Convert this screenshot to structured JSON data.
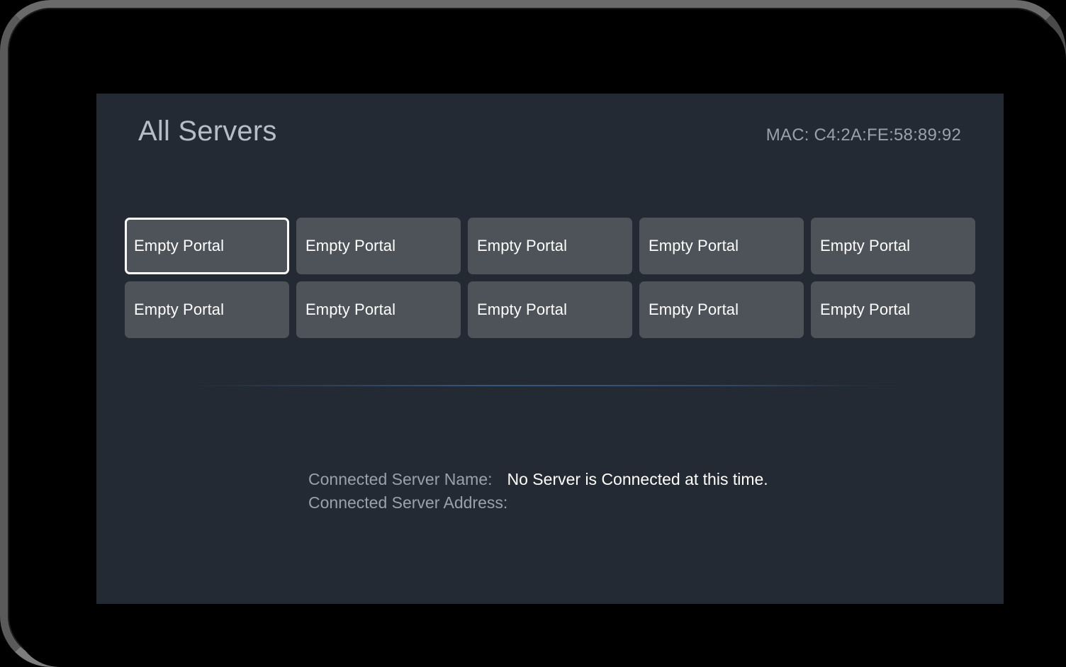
{
  "device": {
    "bezel_color": "#5f5f5f",
    "screen_background": "#000000"
  },
  "app": {
    "panel_background": "#242a33",
    "header": {
      "title": "All Servers",
      "mac_label": "MAC: C4:2A:FE:58:89:92"
    },
    "portals": {
      "tile_background": "#4d5359",
      "focus_border_color": "#ffffff",
      "focused_index": 0,
      "items": [
        {
          "label": "Empty Portal"
        },
        {
          "label": "Empty Portal"
        },
        {
          "label": "Empty Portal"
        },
        {
          "label": "Empty Portal"
        },
        {
          "label": "Empty Portal"
        },
        {
          "label": "Empty Portal"
        },
        {
          "label": "Empty Portal"
        },
        {
          "label": "Empty Portal"
        },
        {
          "label": "Empty Portal"
        },
        {
          "label": "Empty Portal"
        }
      ]
    },
    "divider": {
      "accent_color": "#38608c"
    },
    "connection": {
      "name_label": "Connected Server Name:",
      "name_value": "No Server is Connected at this time.",
      "address_label": "Connected Server Address:",
      "address_value": ""
    }
  }
}
